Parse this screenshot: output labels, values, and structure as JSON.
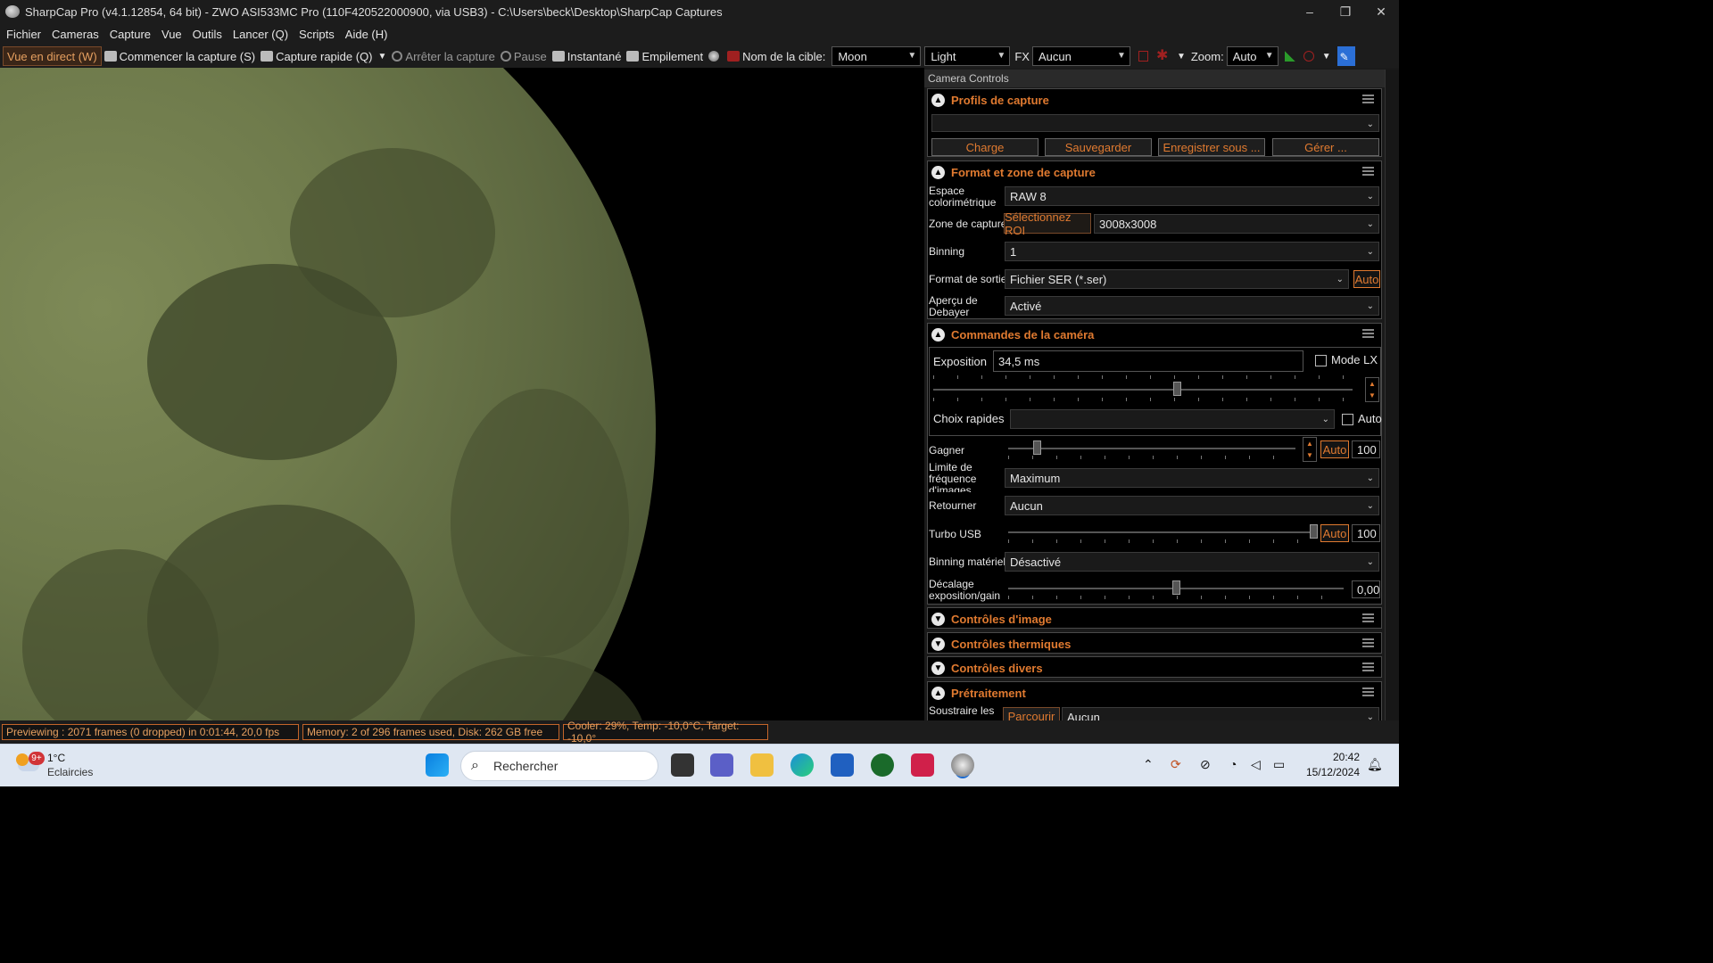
{
  "window": {
    "title": "SharpCap Pro (v4.1.12854, 64 bit) - ZWO ASI533MC Pro (110F420522000900, via USB3) - C:\\Users\\beck\\Desktop\\SharpCap Captures",
    "minimize": "–",
    "maximize": "❐",
    "close": "✕"
  },
  "menu": [
    "Fichier",
    "Cameras",
    "Capture",
    "Vue",
    "Outils",
    "Lancer (Q)",
    "Scripts",
    "Aide (H)"
  ],
  "toolbar": {
    "live": "Vue en direct (W)",
    "start_capture": "Commencer la capture (S)",
    "quick_capture": "Capture rapide (Q)",
    "stop_capture": "Arrêter la capture",
    "pause": "Pause",
    "snapshot": "Instantané",
    "stack": "Empilement",
    "target_label": "Nom de la cible:",
    "target_value": "Moon",
    "frame_type": "Light",
    "fx_label": "FX",
    "fx_value": "Aucun",
    "zoom_label": "Zoom:",
    "zoom_value": "Auto"
  },
  "panel": {
    "title": "Camera Controls",
    "profiles": {
      "title": "Profils de capture",
      "value": "",
      "buttons": [
        "Charge",
        "Sauvegarder",
        "Enregistrer sous ...",
        "Gérer ..."
      ]
    },
    "format": {
      "title": "Format et zone de capture",
      "color_space_label": "Espace colorimétrique",
      "color_space": "RAW 8",
      "capture_area_label": "Zone de capture",
      "roi_button": "Sélectionnez ROI",
      "capture_area": "3008x3008",
      "binning_label": "Binning",
      "binning": "1",
      "output_label": "Format de sortie",
      "output": "Fichier SER (*.ser)",
      "output_auto": "Auto",
      "debayer_label": "Aperçu de Debayer",
      "debayer": "Activé"
    },
    "camera": {
      "title": "Commandes de la caméra",
      "exposure_label": "Exposition",
      "exposure": "34,5 ms",
      "lx_label": "Mode LX",
      "quick_label": "Choix rapides",
      "quick_value": "",
      "quick_auto": "Auto",
      "gain_label": "Gagner",
      "gain_auto": "Auto",
      "gain": "100",
      "gain_level": 0.1,
      "fps_label": "Limite de fréquence d'images",
      "fps": "Maximum",
      "flip_label": "Retourner",
      "flip": "Aucun",
      "usb_label": "Turbo USB",
      "usb_auto": "Auto",
      "usb": "100",
      "usb_level": 1.0,
      "hwbin_label": "Binning matériel",
      "hwbin": "Désactivé",
      "offset_label": "Décalage exposition/gain",
      "offset": "0,00",
      "offset_level": 0.5,
      "exposure_level": 0.58
    },
    "collapsed": [
      "Contrôles d'image",
      "Contrôles thermiques",
      "Contrôles divers",
      "Prétraitement"
    ],
    "preproc_label": "Soustraire les",
    "preproc_button": "Parcourir",
    "preproc_value": "Aucun"
  },
  "status": {
    "preview": "Previewing : 2071 frames (0 dropped) in 0:01:44, 20,0 fps",
    "memory": "Memory: 2 of 296 frames used, Disk: 262 GB free",
    "cooler": "Cooler: 29%, Temp: -10,0°C, Target: -10,0°"
  },
  "taskbar": {
    "badge": "9+",
    "temp": "1°C",
    "weather": "Eclaircies",
    "search": "Rechercher",
    "time": "20:42",
    "date": "15/12/2024"
  }
}
